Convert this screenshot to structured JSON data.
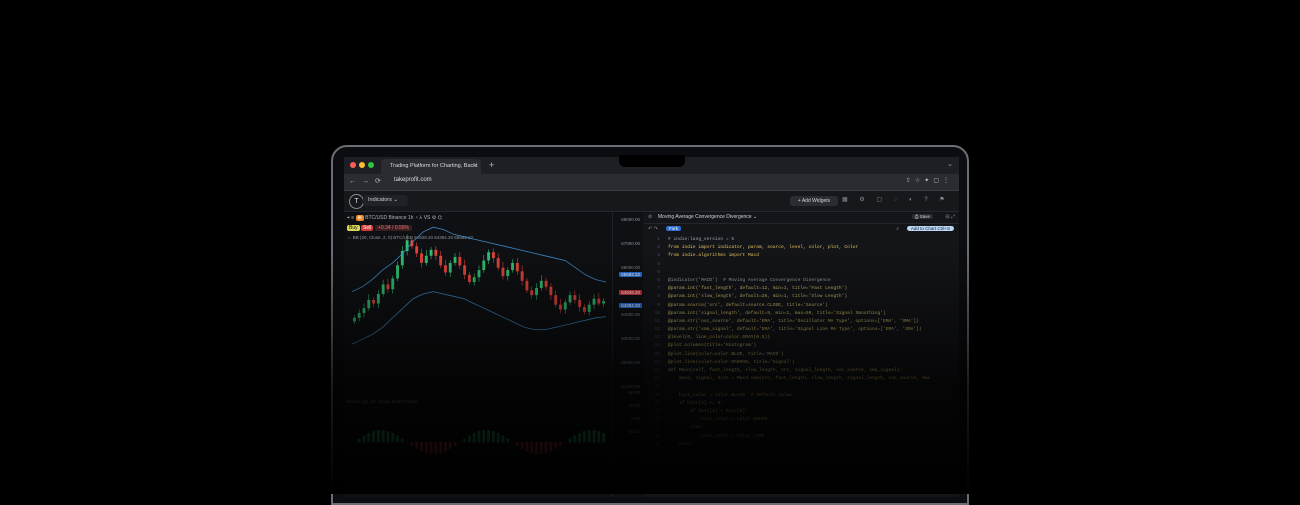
{
  "browser": {
    "tab_title": "Trading Platform for Charting, Backt",
    "tab_close": "×",
    "new_tab": "+",
    "url": "takeprofit.com",
    "nav_icons": "←→⟳",
    "right_icons": "⇧☆✦▢⋮"
  },
  "app": {
    "logo_glyph": "T",
    "indicators_label": "Indicators ⌄",
    "add_widgets_label": "+ Add Widgets",
    "header_icons": "▦ ⚙ ▢ ◌ ◐ ? ⚑"
  },
  "chart": {
    "toolbar": "⌖ ≡",
    "symbol": "⊕",
    "symbol_text": "BTC/USD Binance 1h  ◔  ⅄  VS  ⚙  ⌬",
    "buy": "Buy",
    "sell": "Sell",
    "change": "+0.34 / 0.56%",
    "indicator_line": "⇔ BB (20, Close, 2, 0)  BTC/USD  64928.20  64394.20  65682.22",
    "macd_label": "MACD (12, 26, Close, 9)  BTC/USD",
    "price_ticks": [
      "68000.00",
      "67000.00",
      "66000.00",
      "65000.00",
      "64000.00",
      "63000.00",
      "62000.00",
      "61000.00",
      "60.00",
      "30.00",
      "0.00",
      "-30.00"
    ],
    "price_tags": [
      {
        "value": "65682.22",
        "color": "#2a6fd6"
      },
      {
        "value": "64928.20",
        "color": "#c8323a"
      },
      {
        "value": "64394.20",
        "color": "#2a6fd6"
      }
    ]
  },
  "chart_data": {
    "type": "candlestick",
    "title": "",
    "ylim": [
      61000,
      68000
    ],
    "candles_close": [
      63900,
      64100,
      64300,
      64650,
      64500,
      64900,
      65300,
      65100,
      65550,
      66100,
      66700,
      67150,
      66900,
      66600,
      66200,
      66500,
      66750,
      66500,
      66100,
      65800,
      66200,
      66450,
      66100,
      65700,
      65400,
      65600,
      65900,
      66300,
      66650,
      66400,
      66000,
      65650,
      65900,
      66200,
      65850,
      65450,
      65050,
      64850,
      65150,
      65450,
      65200,
      64850,
      64450,
      64250,
      64550,
      64850,
      64650,
      64350,
      64150,
      64450,
      64700,
      64500,
      64600
    ],
    "bb_upper": [
      65000,
      65200,
      65500,
      65900,
      66200,
      66600,
      67100,
      67500,
      67700,
      67600,
      67400,
      67300,
      67200,
      67100,
      67000,
      66900,
      66800,
      66700,
      66600,
      66500,
      66400,
      66300,
      66000,
      65700,
      65500,
      65400
    ],
    "bb_lower": [
      62800,
      63000,
      63200,
      63500,
      63900,
      64300,
      64700,
      64900,
      65000,
      64900,
      64800,
      64700,
      64500,
      64300,
      64100,
      63900,
      63700,
      63500,
      63400,
      63400,
      63500,
      63600,
      63700,
      63800,
      63900,
      63950
    ],
    "series": [
      {
        "name": "BB (20, Close, 2, 0)",
        "color": "#3f88c5"
      },
      {
        "name": "MACD (12, 26, Close, 9)",
        "color": "#e0443a"
      }
    ]
  },
  "editor": {
    "title": "Moving Average Convergence Divergence ⌄",
    "save": "⎙ Save",
    "fork": "Fork",
    "add_to_chart": "Add to Chart  Ctrl+S",
    "header_icons": "⊟ ⤢",
    "lines": [
      "# indie:lang_version = 5",
      "from indie import indicator, param, source, level, color, plot, Color",
      "from indie.algorithms import Macd",
      "",
      "",
      "@indicator('MACD')  # Moving Average Convergence Divergence",
      "@param.int('fast_length', default=12, min=1, title='Fast Length')",
      "@param.int('slow_length', default=26, min=1, title='Slow Length')",
      "@param.source('src', default=source.CLOSE, title='Source')",
      "@param.int('signal_length', default=9, min=1, max=50, title='Signal Smoothing')",
      "@param.str('osc_source', default='EMA', title='Oscillator MA Type', options=['EMA', 'SMA'])",
      "@param.str('sma_signal', default='EMA', title='Signal Line MA Type', options=['EMA', 'SMA'])",
      "@level(0, line_color=color.GRAY(0.5))",
      "@plot.columns(title='Histogram')",
      "@plot.line(color=color.BLUE, title='MACD')",
      "@plot.line(color=color.MAROON, title='Signal')",
      "def Main(self, fast_length, slow_length, src, signal_length, osc_source, sma_signal):",
      "    macd, signal, hist = Macd.new(src, fast_length, slow_length, signal_length, osc_source, sma",
      "",
      "    hist_color = color.BLACK  # default value",
      "    if hist[0] >= 0:",
      "        if hist[1] < hist[0]:",
      "            hist_color = color.GREEN",
      "        else:",
      "            hist_color = color.LIME",
      "    else:"
    ]
  }
}
